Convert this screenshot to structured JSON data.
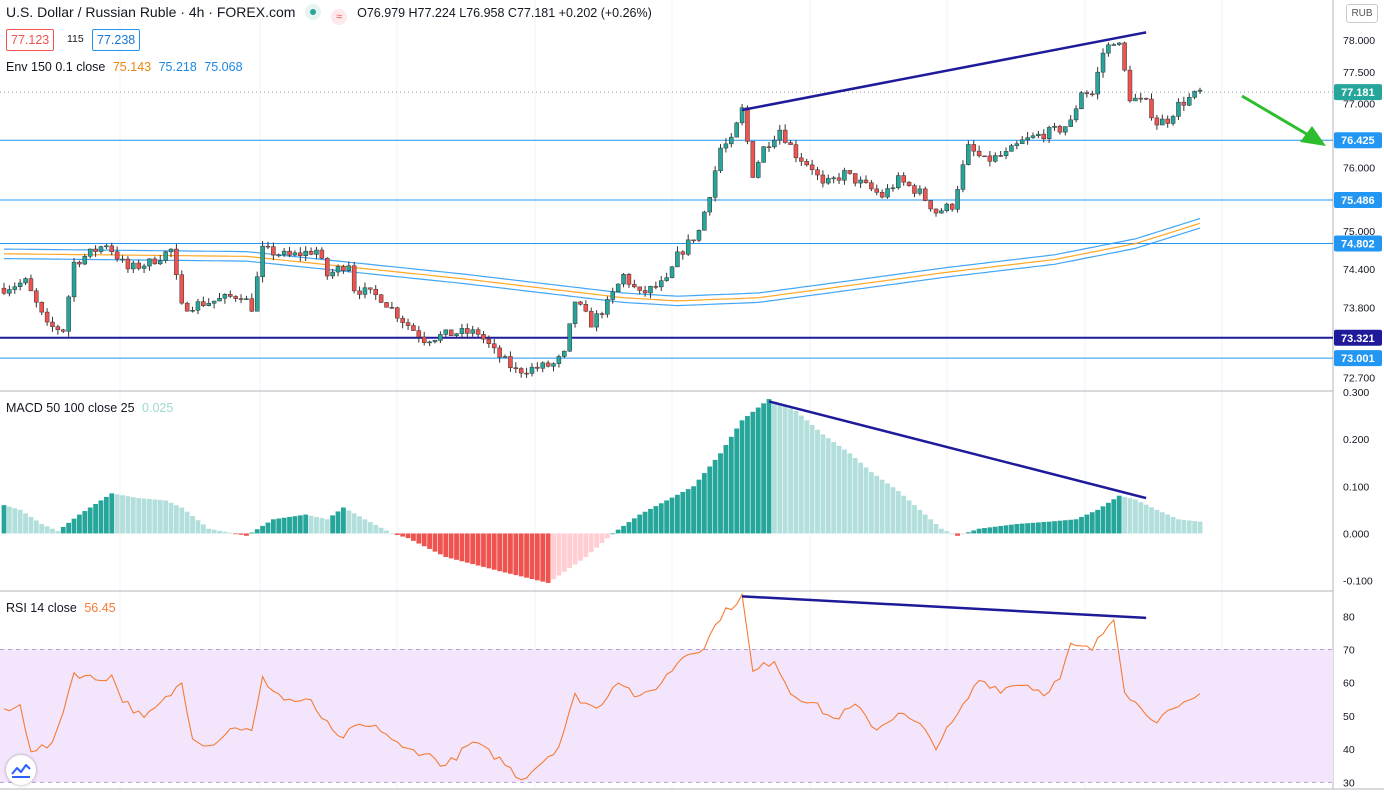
{
  "header": {
    "symbol_title": "U.S. Dollar / Russian Ruble · 4h · FOREX.com",
    "ohlc": "O76.979 H77.224 L76.958 C77.181 +0.202 (+0.26%)",
    "bid": "77.123",
    "spread": "115",
    "ask": "77.238",
    "currency": "RUB"
  },
  "indicators": {
    "env": {
      "label": "Env 150 0.1 close",
      "values": [
        "75.143",
        "75.218",
        "75.068"
      ],
      "colors": [
        "#ff9800",
        "#2196f3",
        "#2196f3"
      ]
    },
    "macd": {
      "label": "MACD 50 100 close 25",
      "value": "0.025"
    },
    "rsi": {
      "label": "RSI 14 close",
      "value": "56.45"
    }
  },
  "colors": {
    "up": "#26a69a",
    "down": "#ef5350",
    "hist_up_strong": "#26a69a",
    "hist_up_weak": "#b2dfdb",
    "hist_down_strong": "#ef5350",
    "hist_down_weak": "#ffcdd2",
    "trendline": "#1e1a9a",
    "hline": "#2196f3",
    "arrow": "#2ebd2e",
    "rsi_line": "#f57c36",
    "rsi_band": "#f3e5fc"
  },
  "chart_data": [
    {
      "type": "candlestick",
      "ylim": [
        72.5,
        78.55
      ],
      "y_ticks": [
        72.7,
        73.0,
        73.3,
        73.8,
        74.4,
        75.0,
        75.5,
        76.0,
        76.5,
        77.0,
        77.5,
        78.0
      ],
      "y_tick_labels": [
        "72.700",
        "73.000",
        "73.300",
        "73.800",
        "74.400",
        "75.000",
        "75.500",
        "76.000",
        "76.500",
        "77.000",
        "77.500",
        "78.000"
      ],
      "price_tags": [
        {
          "value": 77.181,
          "label": "77.181",
          "color": "#26a69a"
        },
        {
          "value": 76.425,
          "label": "76.425",
          "color": "#2196f3"
        },
        {
          "value": 75.486,
          "label": "75.486",
          "color": "#2196f3"
        },
        {
          "value": 74.802,
          "label": "74.802",
          "color": "#2196f3"
        },
        {
          "value": 73.321,
          "label": "73.321",
          "color": "#1e1a9a"
        },
        {
          "value": 73.001,
          "label": "73.001",
          "color": "#2196f3"
        }
      ],
      "horizontal_lines": [
        76.425,
        75.486,
        74.802,
        73.001
      ],
      "support_line": 73.321,
      "envelope_keypoints": [
        [
          0,
          74.64
        ],
        [
          45,
          74.6
        ],
        [
          85,
          74.25
        ],
        [
          115,
          73.95
        ],
        [
          125,
          73.9
        ],
        [
          140,
          73.95
        ],
        [
          155,
          74.12
        ],
        [
          175,
          74.35
        ],
        [
          195,
          74.55
        ],
        [
          210,
          74.8
        ],
        [
          222,
          75.12
        ]
      ],
      "envelope_band_pct": 0.1,
      "trendline": {
        "from": [
          137,
          76.9
        ],
        "to": [
          212,
          78.12
        ]
      },
      "candle_count": 223,
      "waypoints": [
        [
          0,
          74.1
        ],
        [
          4,
          74.2
        ],
        [
          8,
          73.5
        ],
        [
          11,
          73.45
        ],
        [
          13,
          74.5
        ],
        [
          19,
          74.8
        ],
        [
          23,
          74.4
        ],
        [
          27,
          74.5
        ],
        [
          31,
          74.7
        ],
        [
          33,
          73.8
        ],
        [
          39,
          73.9
        ],
        [
          44,
          74.0
        ],
        [
          46,
          73.8
        ],
        [
          48,
          74.7
        ],
        [
          53,
          74.6
        ],
        [
          58,
          74.7
        ],
        [
          60,
          74.3
        ],
        [
          64,
          74.5
        ],
        [
          65,
          74.1
        ],
        [
          70,
          73.95
        ],
        [
          74,
          73.6
        ],
        [
          78,
          73.3
        ],
        [
          84,
          73.4
        ],
        [
          88,
          73.4
        ],
        [
          91,
          73.1
        ],
        [
          95,
          72.8
        ],
        [
          99,
          72.85
        ],
        [
          102,
          72.9
        ],
        [
          104,
          73.05
        ],
        [
          106,
          73.9
        ],
        [
          109,
          73.55
        ],
        [
          112,
          73.85
        ],
        [
          115,
          74.3
        ],
        [
          118,
          74.0
        ],
        [
          123,
          74.2
        ],
        [
          125,
          74.6
        ],
        [
          127,
          74.8
        ],
        [
          129,
          75.0
        ],
        [
          131,
          75.6
        ],
        [
          133,
          76.3
        ],
        [
          135,
          76.4
        ],
        [
          137,
          76.9
        ],
        [
          139,
          75.9
        ],
        [
          141,
          76.3
        ],
        [
          144,
          76.6
        ],
        [
          147,
          76.2
        ],
        [
          150,
          76.0
        ],
        [
          152,
          75.7
        ],
        [
          156,
          75.9
        ],
        [
          160,
          75.7
        ],
        [
          163,
          75.55
        ],
        [
          166,
          75.8
        ],
        [
          170,
          75.6
        ],
        [
          173,
          75.3
        ],
        [
          176,
          75.4
        ],
        [
          179,
          76.3
        ],
        [
          182,
          76.1
        ],
        [
          186,
          76.2
        ],
        [
          189,
          76.4
        ],
        [
          192,
          76.5
        ],
        [
          196,
          76.6
        ],
        [
          198,
          76.7
        ],
        [
          200,
          77.2
        ],
        [
          202,
          77.15
        ],
        [
          204,
          77.8
        ],
        [
          206,
          78.0
        ],
        [
          207,
          77.9
        ],
        [
          208,
          77.5
        ],
        [
          209,
          77.1
        ],
        [
          212,
          77.0
        ],
        [
          214,
          76.7
        ],
        [
          216,
          76.75
        ],
        [
          218,
          76.98
        ],
        [
          222,
          77.181
        ]
      ],
      "title": ""
    },
    {
      "type": "bar",
      "name": "MACD histogram",
      "ylim": [
        -0.12,
        0.3
      ],
      "y_ticks": [
        -0.1,
        0.0,
        0.1,
        0.2,
        0.3
      ],
      "y_tick_labels": [
        "-0.100",
        "0.000",
        "0.100",
        "0.200",
        "0.300"
      ],
      "trendline": {
        "from": [
          142,
          0.28
        ],
        "to": [
          212,
          0.075
        ]
      },
      "waypoints": [
        [
          0,
          0.06
        ],
        [
          3,
          0.05
        ],
        [
          7,
          0.02
        ],
        [
          10,
          0.005
        ],
        [
          14,
          0.04
        ],
        [
          20,
          0.085
        ],
        [
          25,
          0.075
        ],
        [
          30,
          0.07
        ],
        [
          33,
          0.055
        ],
        [
          38,
          0.01
        ],
        [
          45,
          -0.005
        ],
        [
          50,
          0.03
        ],
        [
          56,
          0.04
        ],
        [
          60,
          0.03
        ],
        [
          63,
          0.055
        ],
        [
          67,
          0.03
        ],
        [
          72,
          0.0
        ],
        [
          75,
          -0.01
        ],
        [
          82,
          -0.05
        ],
        [
          92,
          -0.08
        ],
        [
          101,
          -0.105
        ],
        [
          108,
          -0.05
        ],
        [
          113,
          0.0
        ],
        [
          118,
          0.04
        ],
        [
          123,
          0.07
        ],
        [
          128,
          0.1
        ],
        [
          133,
          0.17
        ],
        [
          137,
          0.24
        ],
        [
          142,
          0.285
        ],
        [
          147,
          0.26
        ],
        [
          152,
          0.21
        ],
        [
          157,
          0.17
        ],
        [
          161,
          0.13
        ],
        [
          166,
          0.09
        ],
        [
          170,
          0.05
        ],
        [
          174,
          0.01
        ],
        [
          177,
          -0.005
        ],
        [
          181,
          0.01
        ],
        [
          188,
          0.02
        ],
        [
          194,
          0.025
        ],
        [
          199,
          0.03
        ],
        [
          203,
          0.05
        ],
        [
          207,
          0.08
        ],
        [
          210,
          0.072
        ],
        [
          214,
          0.05
        ],
        [
          218,
          0.03
        ],
        [
          222,
          0.025
        ]
      ],
      "title": ""
    },
    {
      "type": "line",
      "name": "RSI",
      "ylim": [
        28,
        87
      ],
      "y_ticks": [
        30,
        40,
        50,
        60,
        70,
        80
      ],
      "y_tick_labels": [
        "30",
        "40",
        "50",
        "60",
        "70",
        "80"
      ],
      "band": [
        30,
        70
      ],
      "trendline": {
        "from": [
          137,
          86.0
        ],
        "to": [
          212,
          79.5
        ]
      },
      "waypoints": [
        [
          0,
          51
        ],
        [
          3,
          53
        ],
        [
          5,
          40
        ],
        [
          9,
          41
        ],
        [
          13,
          63
        ],
        [
          17,
          61
        ],
        [
          20,
          62
        ],
        [
          22,
          55
        ],
        [
          26,
          49
        ],
        [
          30,
          55
        ],
        [
          33,
          60
        ],
        [
          35,
          44
        ],
        [
          38,
          41
        ],
        [
          43,
          47
        ],
        [
          46,
          45
        ],
        [
          48,
          61
        ],
        [
          52,
          55
        ],
        [
          57,
          54
        ],
        [
          62,
          43
        ],
        [
          66,
          47
        ],
        [
          70,
          46
        ],
        [
          74,
          40
        ],
        [
          78,
          39
        ],
        [
          82,
          35
        ],
        [
          87,
          42
        ],
        [
          92,
          37
        ],
        [
          96,
          31
        ],
        [
          99,
          35
        ],
        [
          103,
          41
        ],
        [
          106,
          56
        ],
        [
          110,
          52
        ],
        [
          114,
          61
        ],
        [
          118,
          55
        ],
        [
          122,
          60
        ],
        [
          126,
          68
        ],
        [
          130,
          71
        ],
        [
          133,
          80
        ],
        [
          137,
          86
        ],
        [
          139,
          63
        ],
        [
          143,
          67
        ],
        [
          146,
          57
        ],
        [
          150,
          54
        ],
        [
          154,
          49
        ],
        [
          158,
          53
        ],
        [
          162,
          46
        ],
        [
          166,
          51
        ],
        [
          170,
          47
        ],
        [
          173,
          41
        ],
        [
          177,
          50
        ],
        [
          181,
          61
        ],
        [
          185,
          58
        ],
        [
          189,
          60
        ],
        [
          193,
          57
        ],
        [
          196,
          61
        ],
        [
          198,
          71
        ],
        [
          202,
          70
        ],
        [
          206,
          80
        ],
        [
          208,
          58
        ],
        [
          211,
          52
        ],
        [
          214,
          49
        ],
        [
          218,
          52
        ],
        [
          222,
          56.45
        ]
      ],
      "title": ""
    }
  ]
}
